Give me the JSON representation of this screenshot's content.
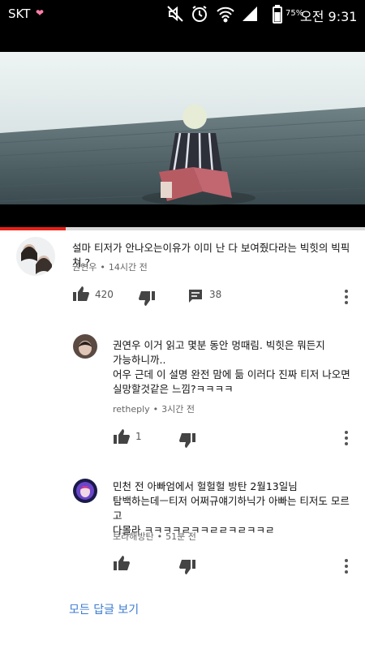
{
  "status_bar": {
    "carrier": "SKT",
    "carrier_icon": "heart-emoji",
    "battery_percent": "75%",
    "time": "오전 9:31",
    "icons": [
      "mute-icon",
      "alarm-icon",
      "wifi-icon",
      "signal-icon",
      "battery-icon"
    ]
  },
  "video": {
    "progress": 0.18,
    "colors": {
      "progress": "#e62117",
      "track": "#d9d9d9"
    }
  },
  "main_comment": {
    "text": "설마 티저가 안나오는이유가 이미 난 다 보여줬다라는 빅힛의 빅픽쳐.?",
    "author": "권연우",
    "time": "14시간 전",
    "likes": "420",
    "replies": "38"
  },
  "replies": [
    {
      "text": "권연우 이거 읽고 몇분 동안 멍때림. 빅힛은 뭐든지\n가능하니까..\n어우 근데 이 설명 완전 맘에 듦 이러다 진짜 티저 나오면\n실망할것같은 느낌?ㅋㅋㅋㅋ",
      "author": "retheply",
      "time": "3시간 전",
      "likes": "1"
    },
    {
      "text": "민천 전 아빠엄에서 헐헐헐 방탄 2월13일님\n탐백하는데ㅡ티저 어쩌규얘기하닉가 아빠는 티저도 모르고\n다몰라 ㅋㅋㅋㅋㄹㅋㅋㄹㄹㅋㄹㅋㅋㄹ",
      "author": "보라해방탄",
      "time": "51분 전",
      "likes": ""
    }
  ],
  "view_all_replies": "모든 답글 보기"
}
